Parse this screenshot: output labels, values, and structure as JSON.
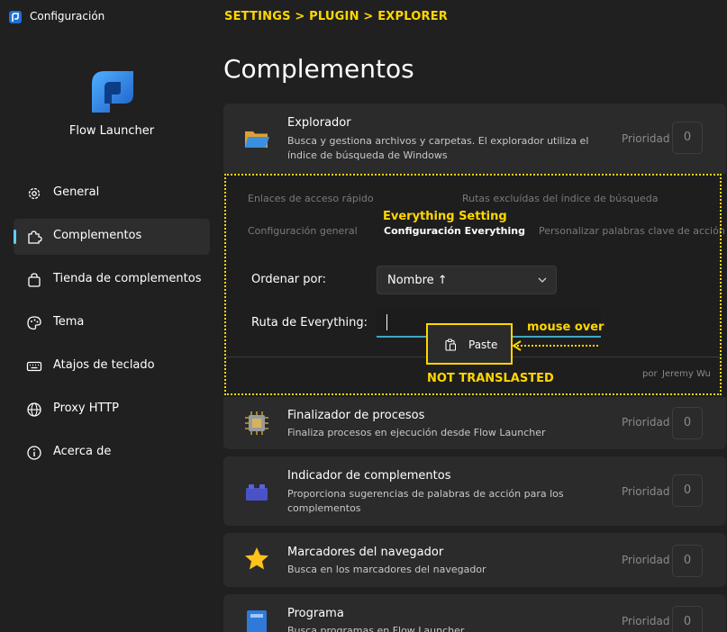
{
  "window": {
    "title": "Configuración"
  },
  "sidebar": {
    "app_name": "Flow Launcher",
    "items": [
      {
        "label": "General",
        "icon": "gear-icon",
        "active": false
      },
      {
        "label": "Complementos",
        "icon": "puzzle-icon",
        "active": true
      },
      {
        "label": "Tienda de complementos",
        "icon": "shopping-bag-icon",
        "active": false
      },
      {
        "label": "Tema",
        "icon": "palette-icon",
        "active": false
      },
      {
        "label": "Atajos de teclado",
        "icon": "keyboard-icon",
        "active": false
      },
      {
        "label": "Proxy HTTP",
        "icon": "globe-icon",
        "active": false
      },
      {
        "label": "Acerca de",
        "icon": "info-icon",
        "active": false
      }
    ]
  },
  "breadcrumb": "SETTINGS > PLUGIN > EXPLORER",
  "page_title": "Complementos",
  "plugins": [
    {
      "name": "Explorador",
      "description": "Busca y gestiona archivos y carpetas. El explorador utiliza el índice de búsqueda de Windows",
      "priority_label": "Prioridad",
      "priority": "0",
      "icon": "folder-icon"
    },
    {
      "name": "Finalizador de procesos",
      "description": "Finaliza procesos en ejecución desde Flow Launcher",
      "priority_label": "Prioridad",
      "priority": "0",
      "icon": "cpu-chip-icon"
    },
    {
      "name": "Indicador de complementos",
      "description": "Proporciona sugerencias de palabras de acción para los complementos",
      "priority_label": "Prioridad",
      "priority": "0",
      "icon": "lego-brick-icon"
    },
    {
      "name": "Marcadores del navegador",
      "description": "Busca en los marcadores del navegador",
      "priority_label": "Prioridad",
      "priority": "0",
      "icon": "star-icon"
    },
    {
      "name": "Programa",
      "description": "Busca programas en Flow Launcher",
      "priority_label": "Prioridad",
      "priority": "0",
      "icon": "program-icon"
    }
  ],
  "explorer_settings": {
    "tabs": [
      "Enlaces de acceso rápido",
      "Rutas excluídas del índice de búsqueda",
      "Configuración general",
      "Configuración Everything",
      "Personalizar palabras clave de acción"
    ],
    "active_tab": "Configuración Everything",
    "sort_label": "Ordenar por:",
    "sort_value": "Nombre ↑",
    "path_label": "Ruta de Everything:",
    "path_value": "",
    "context_menu": {
      "paste_label": "Paste"
    },
    "author_prefix": "por",
    "author": "Jeremy Wu"
  },
  "annotations": {
    "everything_setting": "Everything Setting",
    "mouse_over": "mouse over",
    "not_translated": "NOT TRANSLASTED"
  },
  "colors": {
    "accent": "#60cdff",
    "annotation": "#ffd700",
    "input_underline": "#3fa7c4"
  }
}
